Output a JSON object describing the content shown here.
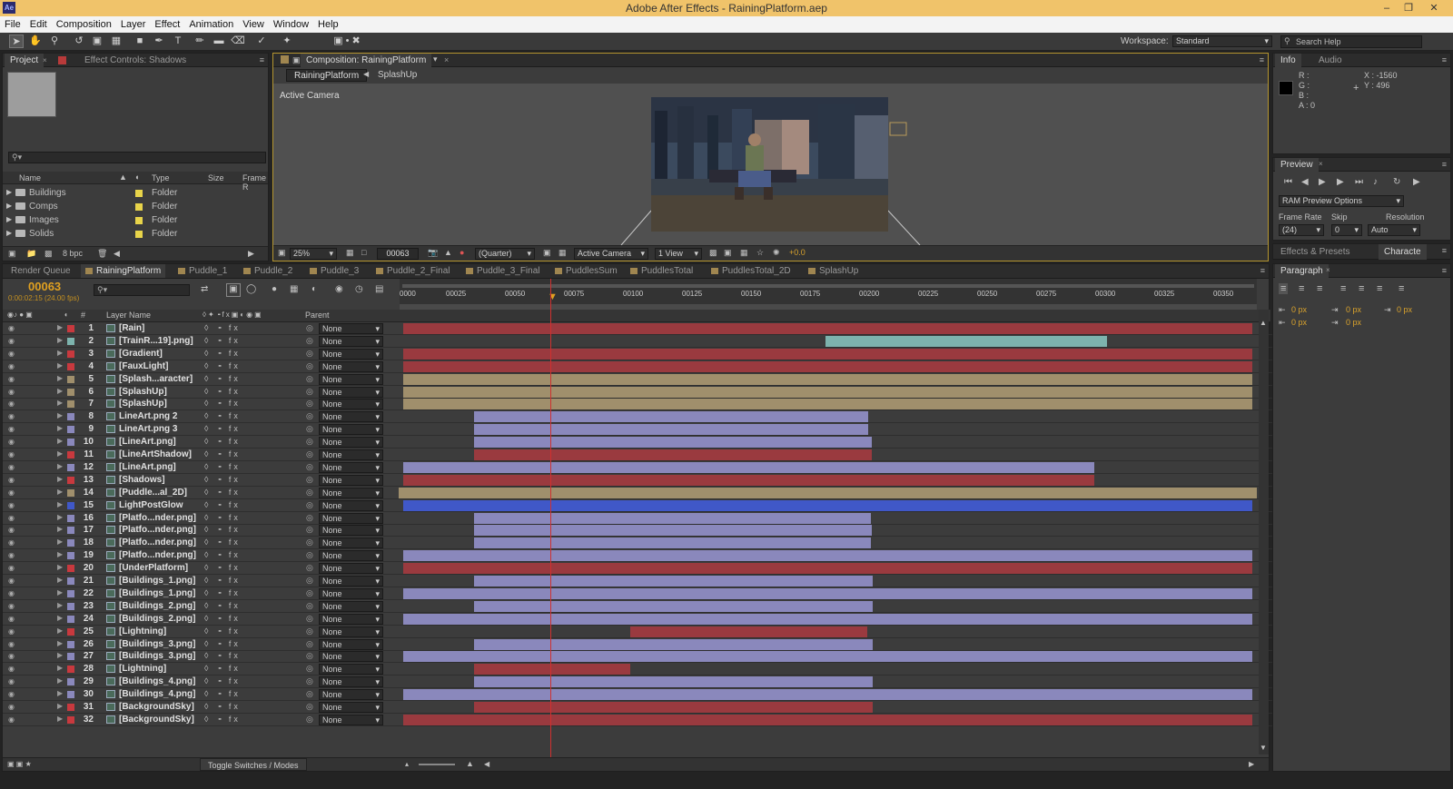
{
  "window": {
    "title": "Adobe After Effects - RainingPlatform.aep",
    "app_icon": "Ae"
  },
  "menu": [
    "File",
    "Edit",
    "Composition",
    "Layer",
    "Effect",
    "Animation",
    "View",
    "Window",
    "Help"
  ],
  "workspace": {
    "label": "Workspace:",
    "value": "Standard"
  },
  "search_help": {
    "placeholder": "Search Help"
  },
  "project_panel": {
    "tabs": [
      "Project",
      "Effect Controls: Shadows"
    ],
    "columns": [
      "Name",
      "Type",
      "Size",
      "Frame R"
    ],
    "items": [
      {
        "name": "Buildings",
        "type": "Folder"
      },
      {
        "name": "Comps",
        "type": "Folder"
      },
      {
        "name": "Images",
        "type": "Folder"
      },
      {
        "name": "Solids",
        "type": "Folder"
      }
    ],
    "bpc": "8 bpc"
  },
  "comp_viewer": {
    "tab": "Composition: RainingPlatform",
    "breadcrumbs": [
      "RainingPlatform",
      "SplashUp"
    ],
    "camera_label": "Active Camera",
    "zoom": "25%",
    "timecode": "00063",
    "resolution": "(Quarter)",
    "camera": "Active Camera",
    "views": "1 View",
    "exposure": "+0.0"
  },
  "info_panel": {
    "tabs": [
      "Info",
      "Audio"
    ],
    "r": "R :",
    "g": "G :",
    "b": "B :",
    "a": "A : 0",
    "x": "X : -1560",
    "y": "Y : 496"
  },
  "preview_panel": {
    "tab": "Preview",
    "ram_options": "RAM Preview Options",
    "frame_rate_label": "Frame Rate",
    "frame_rate": "(24)",
    "skip_label": "Skip",
    "skip": "0",
    "resolution_label": "Resolution",
    "resolution": "Auto"
  },
  "effects_tabs": [
    "Effects & Presets",
    "Characte"
  ],
  "paragraph_panel": {
    "tab": "Paragraph",
    "px": [
      "0 px",
      "0 px",
      "0 px",
      "0 px",
      "0 px"
    ]
  },
  "timeline": {
    "tabs": [
      "Render Queue",
      "RainingPlatform",
      "Puddle_1",
      "Puddle_2",
      "Puddle_3",
      "Puddle_2_Final",
      "Puddle_3_Final",
      "PuddlesSum",
      "PuddlesTotal",
      "PuddlesTotal_2D",
      "SplashUp"
    ],
    "current_time": "00063",
    "current_time_sub": "0:00:02:15 (24.00 fps)",
    "header_layer_name": "Layer Name",
    "header_parent": "Parent",
    "header_hash": "#",
    "ruler": [
      "0000",
      "00025",
      "00050",
      "00075",
      "00100",
      "00125",
      "00150",
      "00175",
      "00200",
      "00225",
      "00250",
      "00275",
      "00300",
      "00325",
      "00350"
    ],
    "toggle_label": "Toggle Switches / Modes",
    "layers": [
      {
        "n": "1",
        "name": "[Rain]",
        "label": "#c8393e",
        "parent": "None",
        "bar": [
          0,
          1,
          "red"
        ]
      },
      {
        "n": "2",
        "name": "[TrainR...19].png]",
        "label": "#7db3ad",
        "parent": "None",
        "bar": [
          0.497,
          0.829,
          "teal"
        ]
      },
      {
        "n": "3",
        "name": "[Gradient]",
        "label": "#c8393e",
        "parent": "None",
        "bar": [
          0,
          1,
          "red"
        ]
      },
      {
        "n": "4",
        "name": "[FauxLight]",
        "label": "#c8393e",
        "parent": "None",
        "bar": [
          0,
          1,
          "red"
        ]
      },
      {
        "n": "5",
        "name": "[Splash...aracter]",
        "label": "#a08f6c",
        "parent": "None",
        "bar": [
          0,
          1,
          "tan"
        ]
      },
      {
        "n": "6",
        "name": "[SplashUp]",
        "label": "#a08f6c",
        "parent": "None",
        "bar": [
          0,
          1,
          "tan"
        ]
      },
      {
        "n": "7",
        "name": "[SplashUp]",
        "label": "#a08f6c",
        "parent": "None",
        "bar": [
          0,
          1,
          "tan"
        ]
      },
      {
        "n": "8",
        "name": "LineArt.png 2",
        "label": "#8a88bc",
        "parent": "None",
        "bar": [
          0.083,
          0.548,
          "lav"
        ]
      },
      {
        "n": "9",
        "name": "LineArt.png 3",
        "label": "#8a88bc",
        "parent": "None",
        "bar": [
          0.083,
          0.548,
          "lav"
        ]
      },
      {
        "n": "10",
        "name": "[LineArt.png]",
        "label": "#8a88bc",
        "parent": "None",
        "bar": [
          0.083,
          0.552,
          "lav"
        ]
      },
      {
        "n": "11",
        "name": "[LineArtShadow]",
        "label": "#c8393e",
        "parent": "None",
        "bar": [
          0.083,
          0.552,
          "red"
        ]
      },
      {
        "n": "12",
        "name": "[LineArt.png]",
        "label": "#8a88bc",
        "parent": "None",
        "bar": [
          0,
          0.814,
          "lav"
        ]
      },
      {
        "n": "13",
        "name": "[Shadows]",
        "label": "#c8393e",
        "parent": "None",
        "bar": [
          0,
          0.814,
          "red"
        ]
      },
      {
        "n": "14",
        "name": "[Puddle...al_2D]",
        "label": "#a08f6c",
        "parent": "None",
        "bar": [
          -0.005,
          1.005,
          "tan"
        ]
      },
      {
        "n": "15",
        "name": "LightPostGlow",
        "label": "#4058c8",
        "parent": "None",
        "bar": [
          0,
          1,
          "blue"
        ]
      },
      {
        "n": "16",
        "name": "[Platfo...nder.png]",
        "label": "#8a88bc",
        "parent": "None",
        "bar": [
          0.083,
          0.551,
          "lav"
        ]
      },
      {
        "n": "17",
        "name": "[Platfo...nder.png]",
        "label": "#8a88bc",
        "parent": "None",
        "bar": [
          0.083,
          0.552,
          "lav"
        ]
      },
      {
        "n": "18",
        "name": "[Platfo...nder.png]",
        "label": "#8a88bc",
        "parent": "None",
        "bar": [
          0.083,
          0.551,
          "lav"
        ]
      },
      {
        "n": "19",
        "name": "[Platfo...nder.png]",
        "label": "#8a88bc",
        "parent": "None",
        "bar": [
          0,
          1,
          "lav"
        ]
      },
      {
        "n": "20",
        "name": "[UnderPlatform]",
        "label": "#c8393e",
        "parent": "None",
        "bar": [
          0,
          1,
          "red"
        ]
      },
      {
        "n": "21",
        "name": "[Buildings_1.png]",
        "label": "#8a88bc",
        "parent": "None",
        "bar": [
          0.083,
          0.553,
          "lav"
        ]
      },
      {
        "n": "22",
        "name": "[Buildings_1.png]",
        "label": "#8a88bc",
        "parent": "None",
        "bar": [
          0,
          1,
          "lav"
        ]
      },
      {
        "n": "23",
        "name": "[Buildings_2.png]",
        "label": "#8a88bc",
        "parent": "None",
        "bar": [
          0.083,
          0.553,
          "lav"
        ]
      },
      {
        "n": "24",
        "name": "[Buildings_2.png]",
        "label": "#8a88bc",
        "parent": "None",
        "bar": [
          0,
          1,
          "lav"
        ]
      },
      {
        "n": "25",
        "name": "[Lightning]",
        "label": "#c8393e",
        "parent": "None",
        "bar": [
          0.267,
          0.546,
          "red"
        ]
      },
      {
        "n": "26",
        "name": "[Buildings_3.png]",
        "label": "#8a88bc",
        "parent": "None",
        "bar": [
          0.083,
          0.553,
          "lav"
        ]
      },
      {
        "n": "27",
        "name": "[Buildings_3.png]",
        "label": "#8a88bc",
        "parent": "None",
        "bar": [
          0,
          1,
          "lav"
        ]
      },
      {
        "n": "28",
        "name": "[Lightning]",
        "label": "#c8393e",
        "parent": "None",
        "bar": [
          0.083,
          0.267,
          "red"
        ]
      },
      {
        "n": "29",
        "name": "[Buildings_4.png]",
        "label": "#8a88bc",
        "parent": "None",
        "bar": [
          0.083,
          0.553,
          "lav"
        ]
      },
      {
        "n": "30",
        "name": "[Buildings_4.png]",
        "label": "#8a88bc",
        "parent": "None",
        "bar": [
          0,
          1,
          "lav"
        ]
      },
      {
        "n": "31",
        "name": "[BackgroundSky]",
        "label": "#c8393e",
        "parent": "None",
        "bar": [
          0.083,
          0.553,
          "red"
        ]
      },
      {
        "n": "32",
        "name": "[BackgroundSky]",
        "label": "#c8393e",
        "parent": "None",
        "bar": [
          0,
          1,
          "red"
        ]
      }
    ]
  }
}
